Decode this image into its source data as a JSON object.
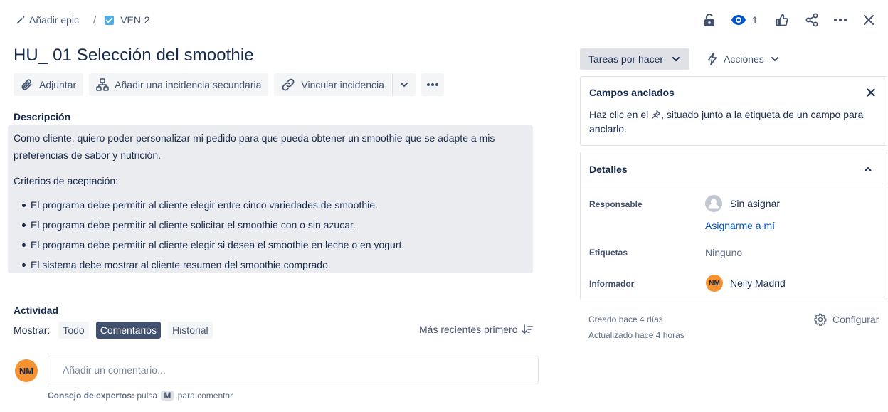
{
  "breadcrumb": {
    "add_epic": "Añadir epic",
    "separator": "/",
    "issue_key": "VEN-2"
  },
  "toolbar": {
    "watch_count": "1"
  },
  "issue": {
    "title": "HU_ 01 Selección del smoothie"
  },
  "actions": {
    "attach": "Adjuntar",
    "add_subtask": "Añadir una incidencia secundaria",
    "link_issue": "Vincular incidencia"
  },
  "description": {
    "label": "Descripción",
    "intro": "Como  cliente, quiero poder personalizar mi pedido para que pueda obtener un smoothie que se adapte a mis preferencias de sabor y nutrición.",
    "criteria_label": "Criterios de aceptación:",
    "criteria": [
      "El programa debe permitir al cliente elegir entre cinco variedades de smoothie.",
      "El programa debe permitir al cliente solicitar el smoothie con o sin azucar.",
      "El programa debe permitir al cliente elegir si desea el smoothie en leche o en yogurt.",
      "El sistema debe mostrar al cliente resumen del smoothie comprado."
    ]
  },
  "activity": {
    "label": "Actividad",
    "show_label": "Mostrar:",
    "filters": [
      "Todo",
      "Comentarios",
      "Historial"
    ],
    "selected_filter": "Comentarios",
    "sort_label": "Más recientes primero",
    "comment_placeholder": "Añadir un comentario...",
    "tip_prefix": "Consejo de expertos:",
    "tip_mid": "pulsa",
    "tip_key": "M",
    "tip_suffix": "para comentar",
    "user_initials": "NM"
  },
  "sidebar": {
    "status": "Tareas por hacer",
    "actions_label": "Acciones",
    "pinned": {
      "title": "Campos anclados",
      "text_before": "Haz clic en el",
      "text_after": ", situado junto a la etiqueta de un campo para anclarlo."
    },
    "details": {
      "title": "Detalles",
      "assignee_label": "Responsable",
      "assignee_value": "Sin asignar",
      "assign_me": "Asignarme a mí",
      "labels_label": "Etiquetas",
      "labels_value": "Ninguno",
      "reporter_label": "Informador",
      "reporter_initials": "NM",
      "reporter_name": "Neily Madrid"
    },
    "created": "Creado hace 4 días",
    "updated": "Actualizado hace 4 horas",
    "configure": "Configurar"
  },
  "colors": {
    "accent": "#0052cc",
    "avatar": "#f79232",
    "selected_pill": "#42526e"
  }
}
